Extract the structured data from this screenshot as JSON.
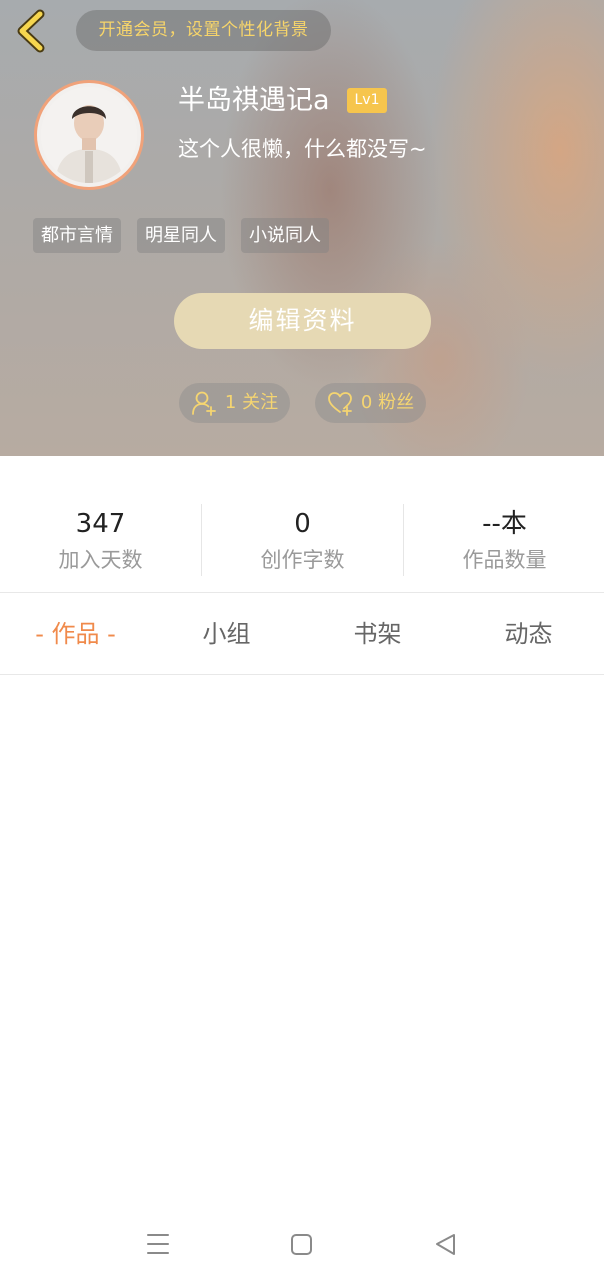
{
  "header": {
    "back_icon": "chevron-left-icon",
    "vip_banner": "开通会员，设置个性化背景",
    "nickname": "半岛祺遇记a",
    "level": "Lv1",
    "bio": "这个人很懒，什么都没写~",
    "tags": [
      "都市言情",
      "明星同人",
      "小说同人"
    ],
    "edit_button": "编辑资料",
    "follow": {
      "icon": "add-user-icon",
      "label": "1 关注"
    },
    "fans": {
      "icon": "heart-icon",
      "label": "0 粉丝"
    },
    "colors": {
      "accent_gold": "#f7d56a",
      "avatar_ring": "#f0a27a",
      "level_badge": "#f6c54d"
    }
  },
  "stats": [
    {
      "value": "347",
      "label": "加入天数"
    },
    {
      "value": "0",
      "label": "创作字数"
    },
    {
      "value": "--本",
      "label": "作品数量"
    }
  ],
  "tabs": [
    {
      "label": "- 作品 -",
      "active": true
    },
    {
      "label": "小组",
      "active": false
    },
    {
      "label": "书架",
      "active": false
    },
    {
      "label": "动态",
      "active": false
    }
  ],
  "tab_active_color": "#f08a4b",
  "navbar": {
    "menu_icon": "menu-icon",
    "home_icon": "home-square-icon",
    "back_icon": "back-triangle-icon"
  }
}
